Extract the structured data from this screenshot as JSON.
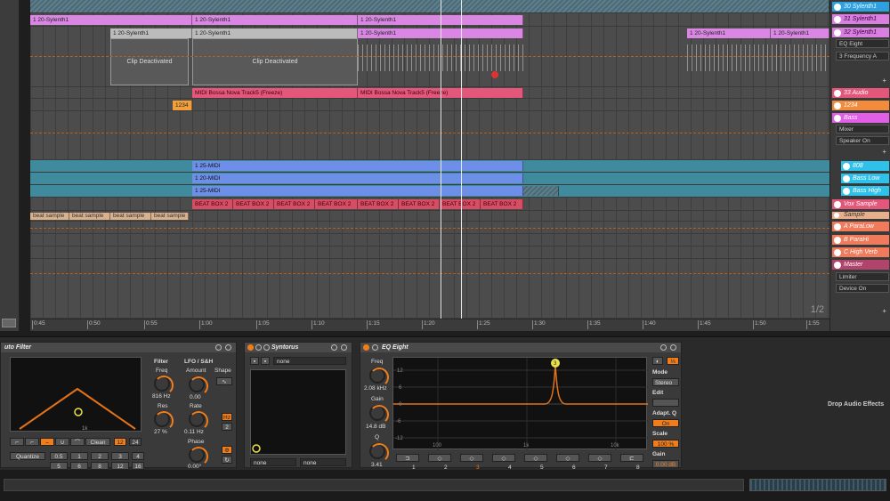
{
  "arrangement": {
    "clips_row0": [
      "1 20-Sylenth1",
      "1 20-Sylenth1",
      "1 20-Sylenth1"
    ],
    "clips_row1": [
      "1 20-Sylenth1",
      "1 20-Sylenth1",
      "1 20-Sylenth1",
      "1 20-Sylenth1",
      "1 20-Sylenth1"
    ],
    "clip_deactivated_1": "Clip Deactivated",
    "clip_deactivated_2": "Clip Deactivated",
    "midi_clips": [
      "MIDI Bossa Nova Track5 (Freeze)",
      "MIDI Bossa Nova Track5 (Freeze)"
    ],
    "orange_clip": "1234",
    "blue_clips": [
      "1 25-MIDI",
      "1 20-MIDI",
      "1 25-MIDI"
    ],
    "beat_box": [
      "BEAT BOX 2",
      "BEAT BOX 2",
      "BEAT BOX 2",
      "BEAT BOX 2",
      "BEAT BOX 2",
      "BEAT BOX 2",
      "BEAT BOX 2",
      "BEAT BOX 2"
    ],
    "sample_clips": [
      "beat sample",
      "beat sample",
      "beat sample",
      "beat sample"
    ],
    "page": "1/2"
  },
  "ruler": {
    "ticks": [
      "0:45",
      "0:50",
      "0:55",
      "1:00",
      "1:05",
      "1:10",
      "1:15",
      "1:20",
      "1:25",
      "1:30",
      "1:35",
      "1:40",
      "1:45",
      "1:50",
      "1:55"
    ]
  },
  "tracks": {
    "t30": "30 Sylenth1",
    "t31": "31 Sylenth1",
    "t32": "32 Sylenth1",
    "t32_device": "EQ Eight",
    "t32_param": "3 Frequency A",
    "t33": "33 Audio",
    "t1234": "1234",
    "bass": "Bass",
    "bass_mixer": "Mixer",
    "bass_speaker": "Speaker On",
    "t808": "808",
    "bass_low": "Bass Low",
    "bass_high": "Bass High",
    "vox": "Vox Sample",
    "sample": "Sample",
    "ret_a": "A ParaLow",
    "ret_b": "B ParaHi",
    "ret_c": "C High Verb",
    "master": "Master",
    "master_dev": "Limiter",
    "master_param": "Device On"
  },
  "auto_filter": {
    "title": "uto Filter",
    "filter": "Filter",
    "freq": "Freq",
    "freq_val": "816 Hz",
    "res": "Res",
    "res_val": "27 %",
    "lfo": "LFO / S&H",
    "amount": "Amount",
    "amount_val": "0.00",
    "shape": "Shape",
    "rate": "Rate",
    "rate_val": "0.11 Hz",
    "hz": "Hz",
    "rate_num": "2",
    "phase": "Phase",
    "phase_val": "0.00°",
    "clean": "Clean",
    "b12": "12",
    "b24": "24",
    "quantize": "Quantize",
    "q_vals": [
      "0.5",
      "1",
      "2",
      "3",
      "4",
      "5",
      "6",
      "8",
      "12",
      "16"
    ],
    "display_mark": "1k"
  },
  "syntorus": {
    "title": "Syntorus",
    "preset": "none",
    "select1": "none",
    "select2": "none"
  },
  "eq_eight": {
    "title": "EQ Eight",
    "freq": "Freq",
    "freq_val": "2.08 kHz",
    "gain": "Gain",
    "gain_val": "14.8 dB",
    "q": "Q",
    "q_val": "3.41",
    "db_labels": [
      "12",
      "6",
      "0",
      "-6",
      "-12"
    ],
    "freq_labels": [
      "100",
      "1k",
      "10k"
    ],
    "mode": "Mode",
    "mode_val": "Stereo",
    "edit": "Edit",
    "adapt_q": "Adapt. Q",
    "adapt_on": "On",
    "scale": "Scale",
    "scale_val": "100 %",
    "gain_label": "Gain",
    "gain_out": "0.00 dB",
    "bands": [
      "1",
      "2",
      "3",
      "4",
      "5",
      "6",
      "7",
      "8"
    ],
    "peak_label": "3"
  },
  "drop_text": "Drop Audio Effects"
}
